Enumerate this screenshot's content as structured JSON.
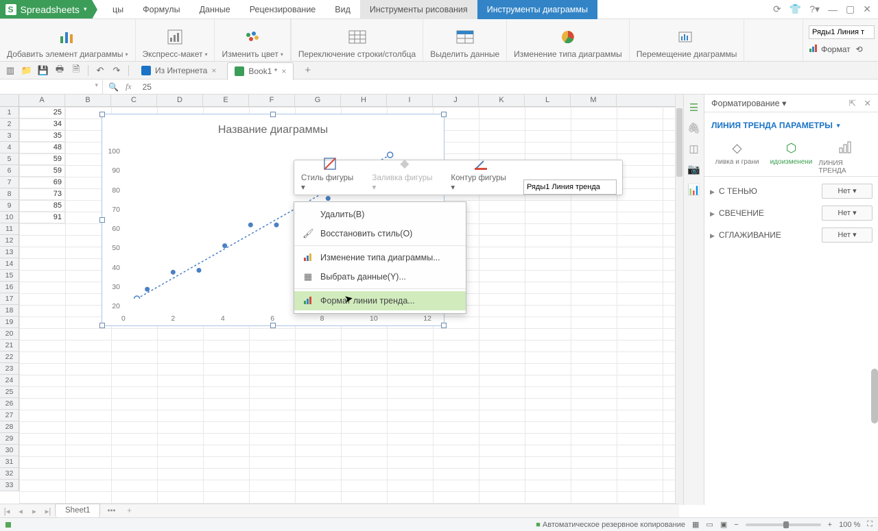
{
  "app": {
    "name": "Spreadsheets"
  },
  "menu": {
    "items": [
      "цы",
      "Формулы",
      "Данные",
      "Рецензирование",
      "Вид",
      "Инструменты рисования",
      "Инструменты диаграммы"
    ],
    "active_drawing_idx": 5,
    "active_chart_idx": 6
  },
  "ribbon": {
    "add_element": "Добавить элемент диаграммы",
    "express": "Экспресс-макет",
    "change_color": "Изменить цвет",
    "switch_rc": "Переключение строки/столбца",
    "select_data": "Выделить данные",
    "change_type": "Изменение типа диаграммы",
    "move_chart": "Перемещение диаграммы",
    "series_box": "Ряды1 Линия т",
    "format_label": "Формат"
  },
  "tabs": {
    "web": "Из Интернета",
    "book": "Book1 *"
  },
  "fx": {
    "value": "25"
  },
  "columns": [
    "A",
    "B",
    "C",
    "D",
    "E",
    "F",
    "G",
    "H",
    "I",
    "J",
    "K",
    "L",
    "M"
  ],
  "rows_count": 33,
  "col_a_values": [
    "25",
    "34",
    "35",
    "48",
    "59",
    "59",
    "69",
    "73",
    "85",
    "91"
  ],
  "chart_data": {
    "type": "scatter",
    "title": "Название диаграммы",
    "x": [
      1,
      2,
      3,
      4,
      5,
      6,
      7,
      8,
      9,
      10
    ],
    "y": [
      25,
      34,
      35,
      48,
      59,
      59,
      69,
      73,
      85,
      91
    ],
    "ylim": [
      0,
      100
    ],
    "xlim": [
      0,
      12
    ],
    "y_ticks": [
      "100",
      "90",
      "80",
      "70",
      "60",
      "50",
      "40",
      "30",
      "20"
    ],
    "x_ticks": [
      "0",
      "2",
      "4",
      "6",
      "8",
      "10",
      "12"
    ],
    "trendline": {
      "type": "linear",
      "x1": 0.6,
      "y1": 20,
      "x2": 10.4,
      "y2": 96
    }
  },
  "mini_toolbar": {
    "shape_style": "Стиль фигуры",
    "shape_fill": "Заливка фигуры",
    "shape_outline": "Контур фигуры",
    "series_box": "Ряды1 Линия тренда"
  },
  "context_menu": {
    "delete": "Удалить(B)",
    "restore": "Восстановить стиль(O)",
    "change_type": "Изменение типа диаграммы...",
    "select_data": "Выбрать данные(Y)...",
    "format_trend": "Формат линии тренда..."
  },
  "format_pane": {
    "title": "Форматирование",
    "section": "ЛИНИЯ ТРЕНДА ПАРАМЕТРЫ",
    "tab1": "ливка и грани",
    "tab2": "идоизменени",
    "tab3": "ЛИНИЯ ТРЕНДА",
    "rows": [
      {
        "label": "С ТЕНЬЮ",
        "value": "Нет"
      },
      {
        "label": "СВЕЧЕНИЕ",
        "value": "Нет"
      },
      {
        "label": "СГЛАЖИВАНИЕ",
        "value": "Нет"
      }
    ]
  },
  "sheet_tabs": {
    "sheet1": "Sheet1"
  },
  "status": {
    "backup": "Автоматическое резервное копирование",
    "zoom": "100 %"
  }
}
